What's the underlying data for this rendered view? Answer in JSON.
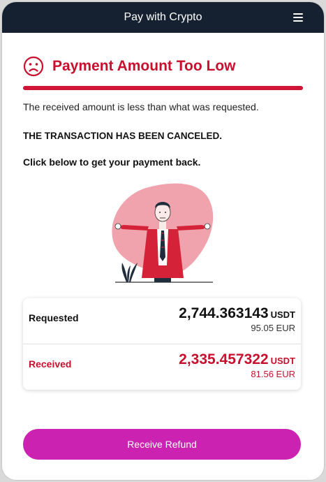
{
  "header": {
    "title": "Pay with Crypto",
    "menu_icon": "hamburger-menu-icon"
  },
  "status": {
    "icon": "sad-face-icon",
    "title": "Payment Amount Too Low",
    "accent_color": "#c8102e",
    "description": "The received amount is less than what was requested.",
    "canceled_notice": "THE TRANSACTION HAS BEEN CANCELED.",
    "instruction": "Click below to get your payment back."
  },
  "summary": {
    "requested": {
      "label": "Requested",
      "amount": "2,744.363143",
      "currency": "USDT",
      "fiat": "95.05 EUR"
    },
    "received": {
      "label": "Received",
      "amount": "2,335.457322",
      "currency": "USDT",
      "fiat": "81.56 EUR"
    }
  },
  "actions": {
    "refund_label": "Receive Refund",
    "refund_color": "#cc22b2"
  }
}
